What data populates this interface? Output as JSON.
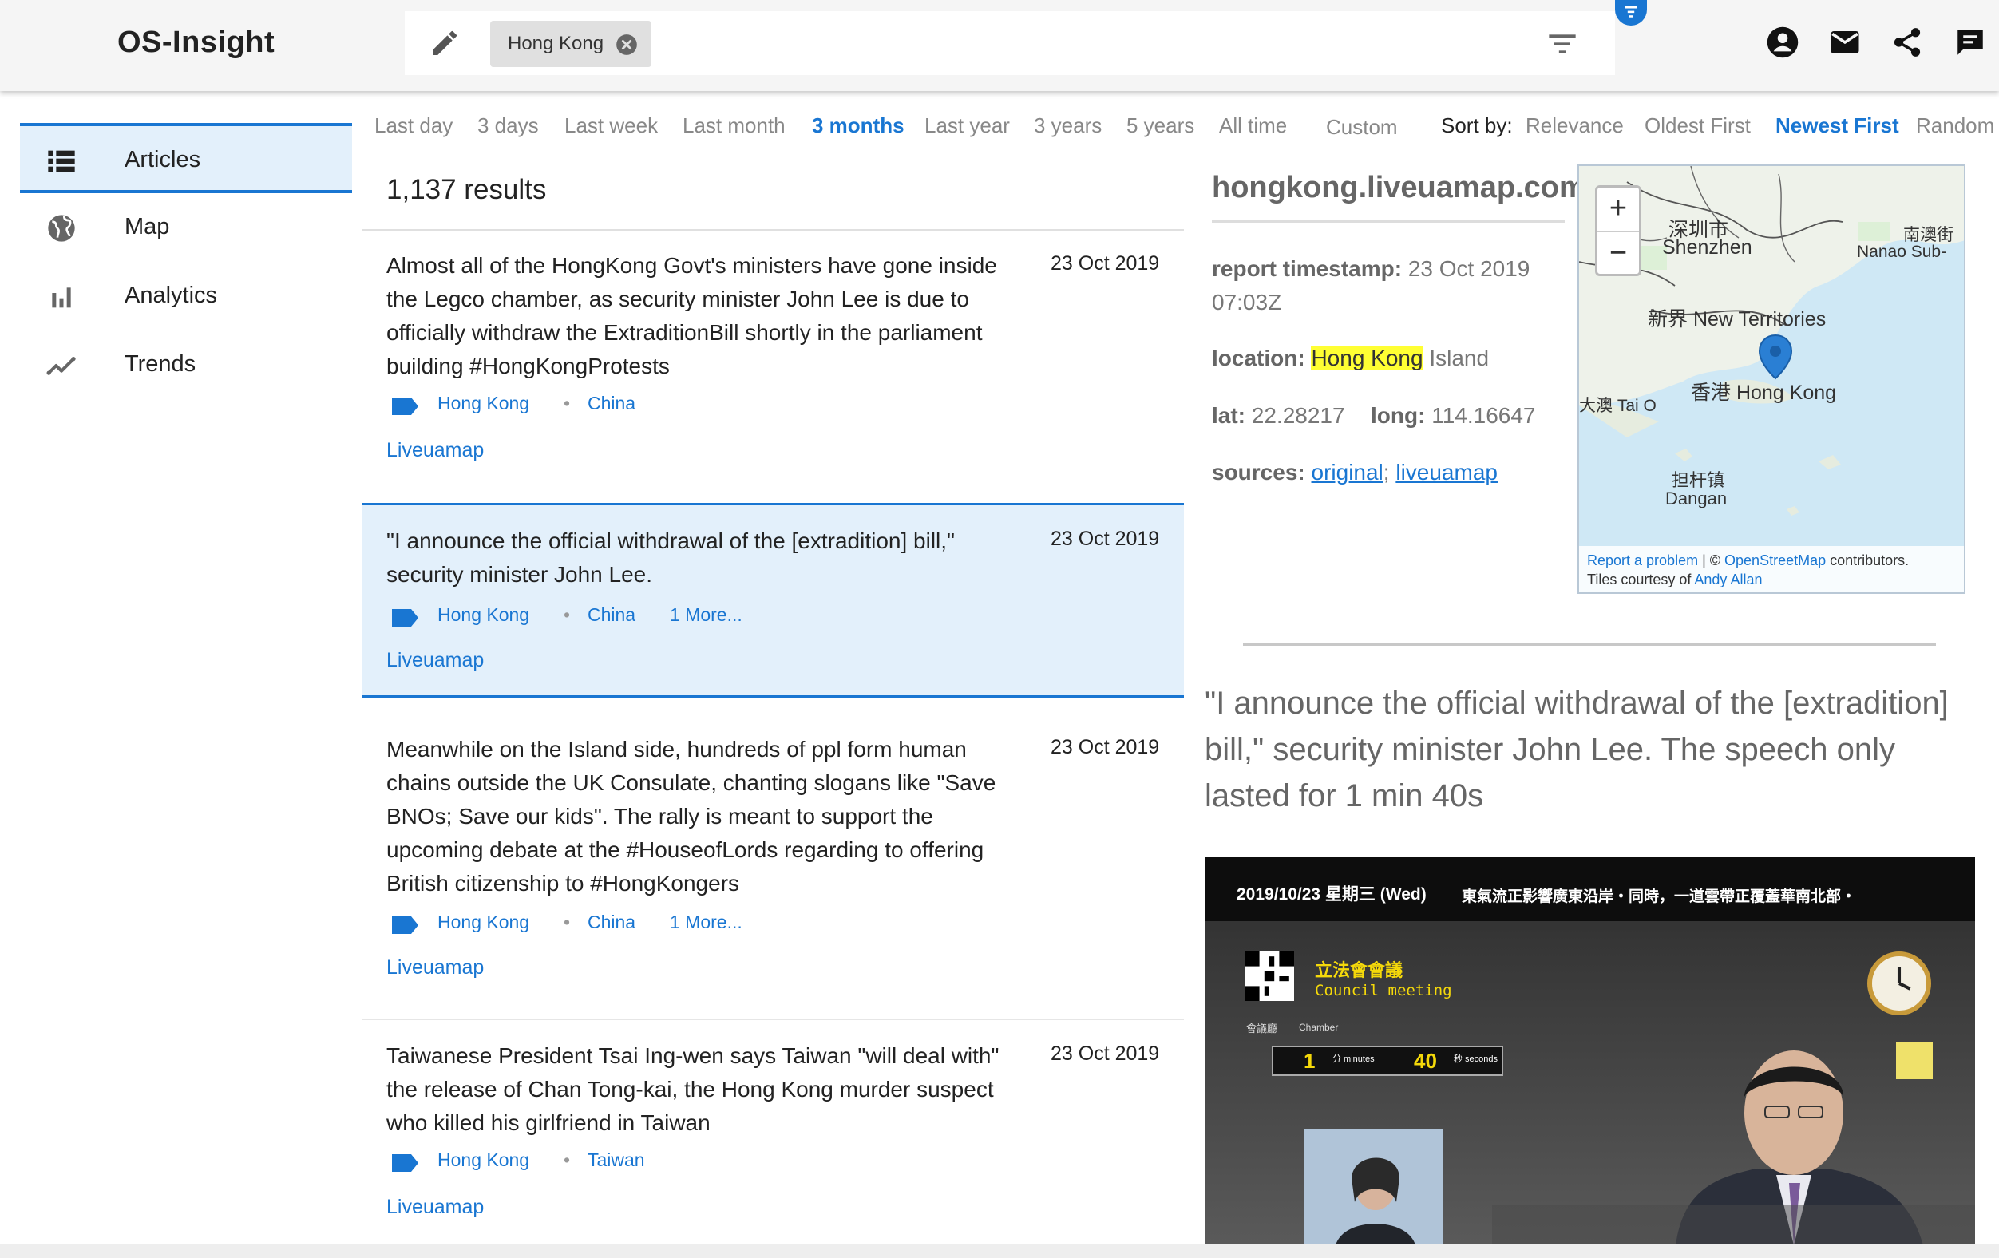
{
  "app": {
    "title": "OS-Insight"
  },
  "search": {
    "chip_label": "Hong Kong"
  },
  "sidebar": {
    "items": [
      {
        "label": "Articles",
        "icon": "list-icon",
        "active": true
      },
      {
        "label": "Map",
        "icon": "globe-icon"
      },
      {
        "label": "Analytics",
        "icon": "bar-chart-icon"
      },
      {
        "label": "Trends",
        "icon": "trend-line-icon"
      }
    ]
  },
  "time_filters": [
    "Last day",
    "3 days",
    "Last week",
    "Last month",
    "3 months",
    "Last year",
    "3 years",
    "5 years",
    "All time",
    "Custom"
  ],
  "active_time_filter": "3 months",
  "sort": {
    "label": "Sort by:",
    "options": [
      "Relevance",
      "Oldest First",
      "Newest First",
      "Random"
    ],
    "active": "Newest First"
  },
  "results": {
    "count": "1,137 results",
    "articles": [
      {
        "title": "Almost all of the HongKong Govt's ministers have gone inside the Legco chamber, as security minister John Lee is due to officially withdraw the ExtraditionBill shortly in the parliament building #HongKongProtests",
        "date": "23 Oct 2019",
        "tags": [
          "Hong Kong",
          "China"
        ],
        "more": "",
        "source": "Liveuamap"
      },
      {
        "title": "\"I announce the official withdrawal of the [extradition] bill,\" security minister John Lee.",
        "date": "23 Oct 2019",
        "tags": [
          "Hong Kong",
          "China"
        ],
        "more": "1 More...",
        "source": "Liveuamap"
      },
      {
        "title": "Meanwhile on the Island side, hundreds of ppl form human chains outside the UK Consulate, chanting slogans like \"Save BNOs; Save our kids\". The rally is meant to support the upcoming debate at the #HouseofLords regarding to offering British citizenship to #HongKongers",
        "date": "23 Oct 2019",
        "tags": [
          "Hong Kong",
          "China"
        ],
        "more": "1 More...",
        "source": "Liveuamap"
      },
      {
        "title": "Taiwanese President Tsai Ing-wen says Taiwan \"will deal with\" the release of Chan Tong-kai, the Hong Kong murder suspect who killed his girlfriend in Taiwan",
        "date": "23 Oct 2019",
        "tags": [
          "Hong Kong",
          "Taiwan"
        ],
        "more": "",
        "source": "Liveuamap"
      }
    ]
  },
  "detail": {
    "domain": "hongkong.liveuamap.com",
    "timestamp_label": "report timestamp:",
    "timestamp_value": "23 Oct 2019 07:03Z",
    "location_label": "location:",
    "location_highlight": "Hong Kong",
    "location_rest": "Island",
    "lat_label": "lat:",
    "lat_value": "22.28217",
    "long_label": "long:",
    "long_value": "114.16647",
    "sources_label": "sources:",
    "source_links": [
      "original",
      "liveuamap"
    ],
    "quote": "\"I announce the official withdrawal of the [extradition] bill,\" security minister John Lee. The speech only lasted for 1 min 40s"
  },
  "map": {
    "zoom_in": "+",
    "zoom_out": "−",
    "labels": {
      "shenzhen_cn": "深圳市",
      "shenzhen": "Shenzhen",
      "nanao_cn": "南澳街",
      "nanao": "Nanao Sub-",
      "new_territories": "新界 New Territories",
      "hong_kong": "香港 Hong Kong",
      "tai_o": "大澳 Tai O",
      "dangan_cn": "担杆镇",
      "dangan": "Dangan"
    },
    "attribution": {
      "report": "Report a problem",
      "osm": "OpenStreetMap",
      "contributors": "contributors.",
      "tiles": "Tiles courtesy of",
      "andy": "Andy Allan"
    }
  },
  "video": {
    "banner_date": "2019/10/23 星期三 (Wed)",
    "banner_news": "東氣流正影響廣東沿岸・同時，一道雲帶正覆蓋華南北部・",
    "council_cn": "立法會會議",
    "council_en": "Council meeting",
    "chamber_cn": "會議廳",
    "chamber_en": "Chamber",
    "timer_min": "1",
    "timer_min_label": "分 minutes",
    "timer_sec": "40",
    "timer_sec_label": "秒 seconds"
  },
  "colors": {
    "accent": "#1976d2",
    "selected_bg": "#e3f0fb",
    "highlight": "#ffff33"
  }
}
